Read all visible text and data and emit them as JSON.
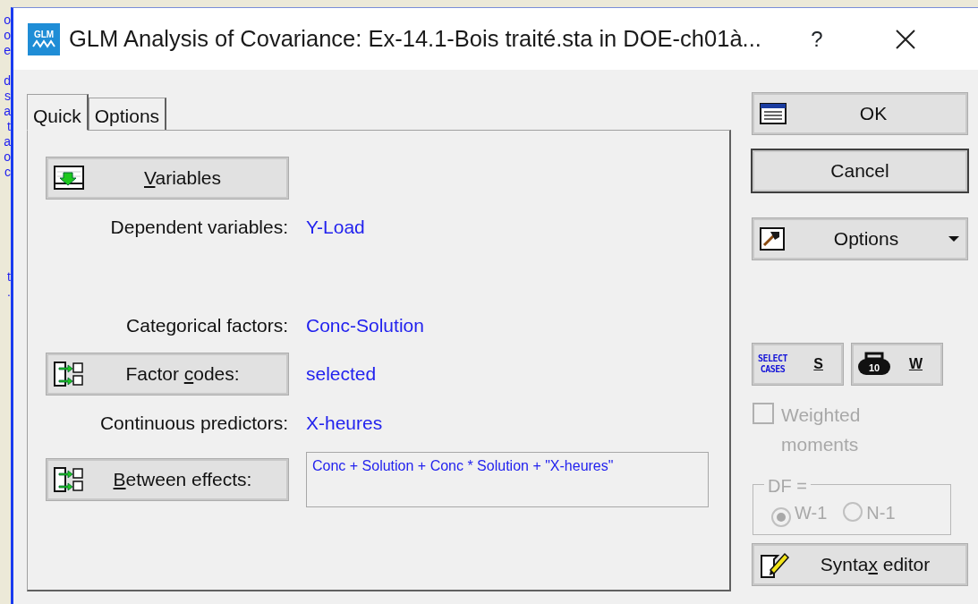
{
  "background_window": {
    "fragment_groups": [
      [
        "o",
        "o",
        "e"
      ],
      [
        "d",
        "s",
        "a",
        "t",
        "a",
        "o",
        "c"
      ],
      [
        "t",
        "."
      ]
    ]
  },
  "window": {
    "title": "GLM Analysis of Covariance: Ex-14.1-Bois traité.sta in DOE-ch01à...",
    "icon_text": "GLM",
    "help": "?"
  },
  "tabs": [
    {
      "label": "Quick",
      "selected": true
    },
    {
      "label": "Options",
      "selected": false
    }
  ],
  "quick_rows": [
    {
      "kind": "select",
      "pre": "",
      "key": "V",
      "post": "ariables"
    },
    {
      "kind": "label",
      "label": "Dependent variables:",
      "value": "Y-Load"
    },
    {
      "kind": "label",
      "label": "Categorical factors:",
      "value": "Conc-Solution"
    },
    {
      "kind": "codes",
      "pre": "Factor ",
      "key": "c",
      "post": "odes:",
      "value": "selected"
    },
    {
      "kind": "label",
      "label": "Continuous predictors:",
      "value": "X-heures"
    },
    {
      "kind": "effects",
      "pre": "",
      "key": "B",
      "post": "etween effects:",
      "value": "Conc + Solution + Conc * Solution + \"X-heures\""
    }
  ],
  "side_buttons": [
    {
      "kind": "ok",
      "label": "OK",
      "default": false
    },
    {
      "kind": "cancel",
      "label": "Cancel",
      "default": true
    },
    {
      "kind": "options",
      "label": "Options",
      "default": false
    }
  ],
  "case_buttons": [
    {
      "kind": "select_cases",
      "icon_lines": [
        "SELECT",
        "CASES"
      ],
      "key": "S"
    },
    {
      "kind": "weight",
      "icon_lines": [
        "10"
      ],
      "key": "W"
    }
  ],
  "weighted_moments": {
    "label": "Weighted moments",
    "checked": false,
    "disabled": true
  },
  "df_group": {
    "legend": "DF =",
    "disabled": true,
    "options": [
      {
        "label": "W-1",
        "selected": true
      },
      {
        "label": "N-1",
        "selected": false
      }
    ]
  },
  "syntax_button": {
    "pre": "Synta",
    "key": "x",
    "post": " editor"
  }
}
